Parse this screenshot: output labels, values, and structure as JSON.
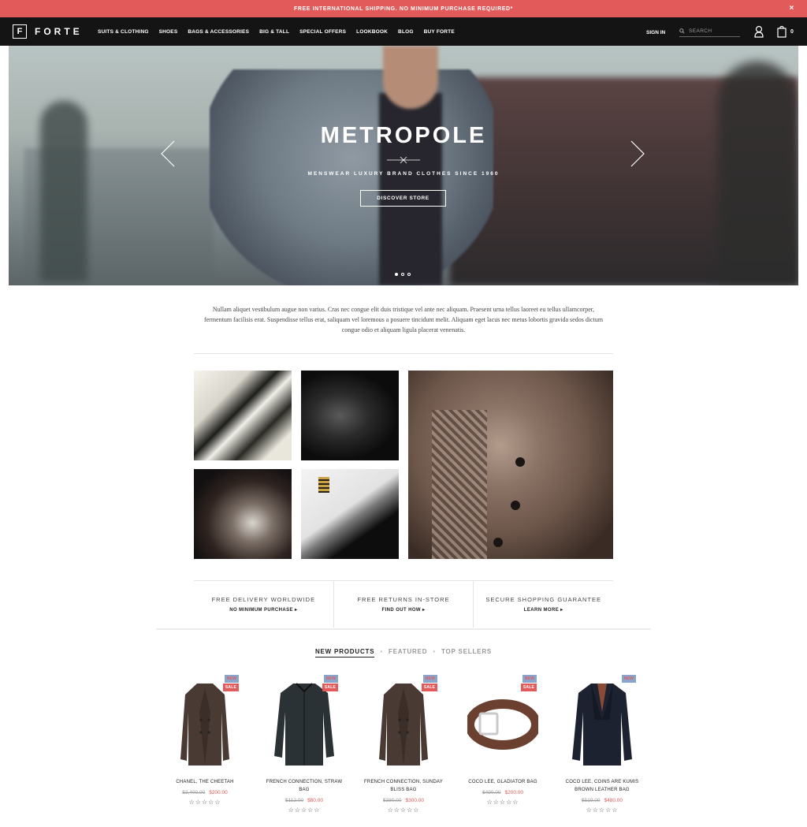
{
  "announcement": {
    "text": "FREE INTERNATIONAL SHIPPING. NO MINIMUM PURCHASE REQUIRED*",
    "close": "×"
  },
  "header": {
    "logo_mark": "F",
    "logo_text": "FORTE",
    "menu": [
      "SUITS & CLOTHING",
      "SHOES",
      "BAGS & ACCESSORIES",
      "BIG & TALL",
      "SPECIAL OFFERS",
      "LOOKBOOK",
      "BLOG",
      "BUY FORTE"
    ],
    "signin": "SIGN IN",
    "search_placeholder": "SEARCH",
    "cart_count": "0"
  },
  "hero": {
    "title": "METROPOLE",
    "subtitle": "MENSWEAR LUXURY BRAND CLOTHES SINCE 1960",
    "button": "DISCOVER STORE",
    "slide_count": 3,
    "active_slide": 1
  },
  "intro": "Nullam aliquet vestibulum augue non varius. Cras nec congue elit duis tristique vel ante nec aliquam. Praesent urna tellus laoreet eu tellus ullamcorper, fermentum facilisis erat. Suspendisse tellus erat, saliquam vel loremous a posuere tincidunt melit. Aliquam eget lacus nec metus lobortis gravida sedos dictum congue odio et aliquam ligula placerat venenatis.",
  "features": [
    {
      "title": "FREE DELIVERY WORLDWIDE",
      "link": "NO MINIMUM PURCHASE ▸"
    },
    {
      "title": "FREE RETURNS IN-STORE",
      "link": "FIND OUT HOW ▸"
    },
    {
      "title": "SECURE SHOPPING GUARANTEE",
      "link": "LEARN MORE ▸"
    }
  ],
  "tabs": {
    "items": [
      "NEW PRODUCTS",
      "FEATURED",
      "TOP SELLERS"
    ],
    "active": 0,
    "separator": "•"
  },
  "badges": {
    "new": "NEW",
    "sale": "SALE"
  },
  "products": [
    {
      "name": "CHANEL, THE CHEETAH",
      "old_price": "$3,400.00",
      "price": "$200.00",
      "new": true,
      "sale": true,
      "stars": "☆☆☆☆☆"
    },
    {
      "name": "FRENCH CONNECTION, STRAW BAG",
      "old_price": "$112.00",
      "price": "$80.00",
      "new": true,
      "sale": true,
      "stars": "☆☆☆☆☆"
    },
    {
      "name": "FRENCH CONNECTION, SUNDAY BLISS BAG",
      "old_price": "$380.00",
      "price": "$300.00",
      "new": true,
      "sale": true,
      "stars": "☆☆☆☆☆"
    },
    {
      "name": "COCO LEE, GLADIATOR BAG",
      "old_price": "$490.00",
      "price": "$200.00",
      "new": true,
      "sale": true,
      "stars": "☆☆☆☆☆"
    },
    {
      "name": "COCO LEE, COINS ARE KUMIS BROWN LEATHER BAG",
      "old_price": "$519.00",
      "price": "$480.00",
      "new": true,
      "sale": false,
      "stars": "☆☆☆☆☆"
    }
  ],
  "colors": {
    "accent": "#e25a5a",
    "nav_bg": "#141414",
    "badge_new": "#8aa5cc"
  }
}
